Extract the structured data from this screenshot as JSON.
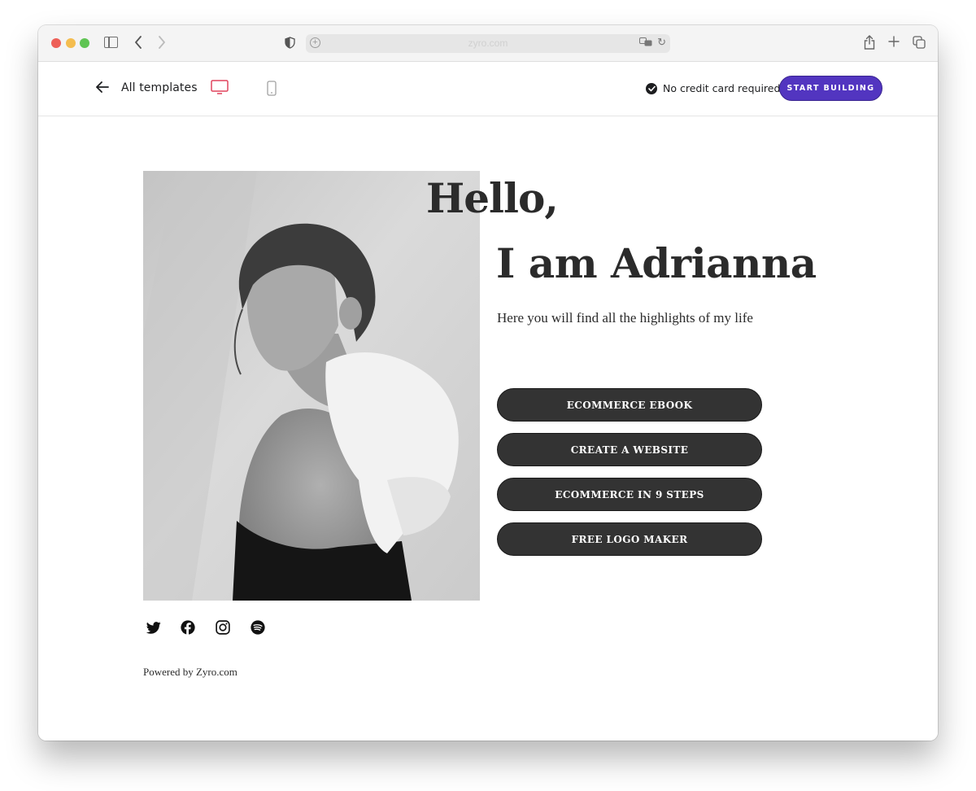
{
  "browser": {
    "url": "zyro.com",
    "controls": {
      "close": "close-window",
      "minimize": "minimize-window",
      "zoom": "zoom-window"
    }
  },
  "topbar": {
    "back_label": "All templates",
    "credit_note": "No credit card required",
    "start_button": "START BUILDING",
    "accent_color": "#5235c0",
    "active_device": "desktop",
    "active_device_color": "#e0445d"
  },
  "hero": {
    "greeting": "Hello,",
    "name": "I am Adrianna",
    "subtitle": "Here you will find all the highlights of my life",
    "photo_alt": "Black and white portrait of a woman with a white bow on her shoulder"
  },
  "links": [
    {
      "label": "ECOMMERCE EBOOK"
    },
    {
      "label": "CREATE A WEBSITE"
    },
    {
      "label": "ECOMMERCE IN 9 STEPS"
    },
    {
      "label": "FREE LOGO MAKER"
    }
  ],
  "social": [
    {
      "name": "twitter"
    },
    {
      "name": "facebook"
    },
    {
      "name": "instagram"
    },
    {
      "name": "spotify"
    }
  ],
  "footer": {
    "powered_by": "Powered by Zyro.com"
  }
}
